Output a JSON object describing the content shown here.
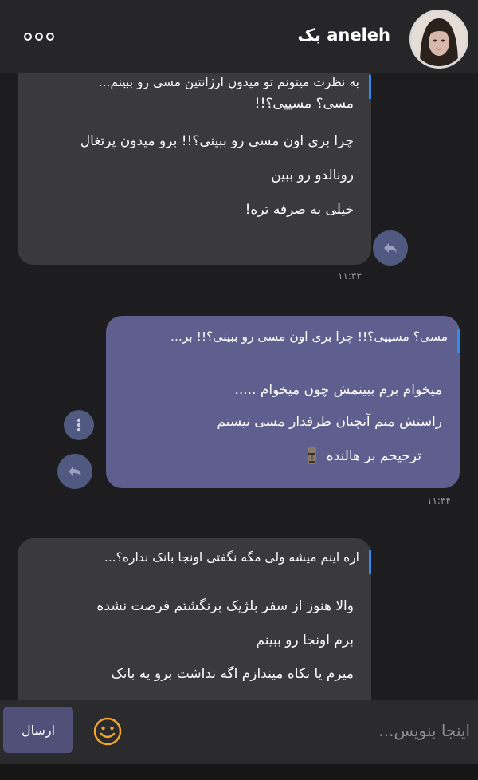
{
  "header": {
    "contact_name": "aneleh بک",
    "menu_icon": "more-dots-icon"
  },
  "messages": [
    {
      "direction": "incoming",
      "quote": "به نظرت میتونم تو میدون ارژانتین مسی رو ببینم...",
      "lines": [
        "مسی؟ مسییی؟!!",
        "چرا بری اون مسی رو ببینی؟!! برو میدون پرتغال",
        "رونالدو رو ببین",
        "خیلی به صرفه تره!"
      ],
      "time": "۱۱:۳۳"
    },
    {
      "direction": "outgoing",
      "quote": "مسی؟ مسییی؟!! چرا بری اون مسی رو ببینی؟!! بر...",
      "lines": [
        "میخوام برم ببینمش چون میخوام .....",
        "راستش منم آنچنان طرفدار مسی نیستم",
        "ترجیحم بر هالنده"
      ],
      "time": "۱۱:۳۴"
    },
    {
      "direction": "incoming",
      "quote": "اره اینم میشه ولی مگه نگفتی اونجا بانک نداره؟...",
      "lines": [
        "والا هنوز از سفر بلژیک برنگشتم فرصت نشده",
        "برم اونجا رو ببینم",
        "میرم یا نکاه میندازم اگه نداشت برو یه بانک"
      ]
    }
  ],
  "composer": {
    "placeholder": "اینجا بنویس...",
    "send_label": "ارسال"
  },
  "colors": {
    "incoming_bubble": "#3a3a3c",
    "outgoing_bubble": "#5f5f8f",
    "quote_bar": "#2d8cf0",
    "emoji_accent": "#f5a623"
  }
}
